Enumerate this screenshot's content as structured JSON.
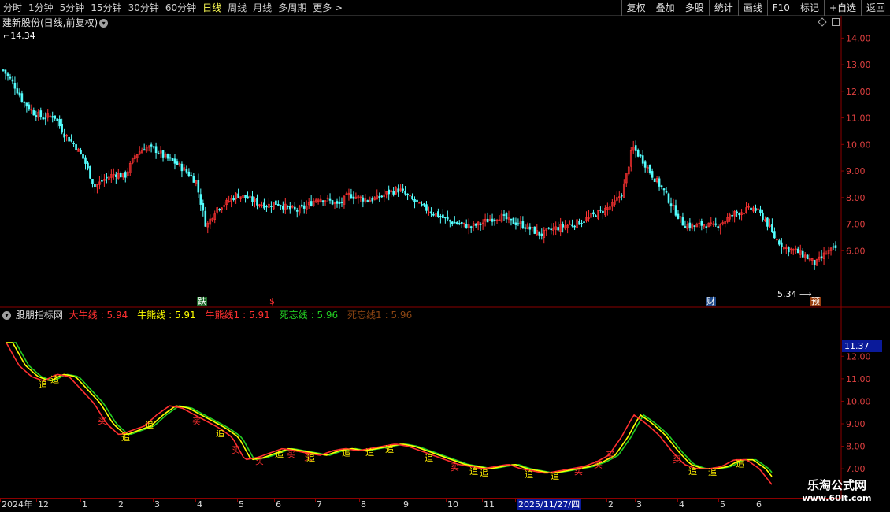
{
  "toolbar": {
    "periods": [
      "分时",
      "1分钟",
      "5分钟",
      "15分钟",
      "30分钟",
      "60分钟",
      "日线",
      "周线",
      "月线",
      "多周期",
      "更多 >"
    ],
    "active_period": "日线",
    "tools": [
      "复权",
      "叠加",
      "多股",
      "统计",
      "画线",
      "F10",
      "标记",
      "+自选",
      "返回"
    ]
  },
  "main_chart": {
    "title": "建新股份(日线,前复权)",
    "high_label": "14.34",
    "low_label": "5.34",
    "markers": {
      "die": "跌",
      "s": "$",
      "cai": "财",
      "yu": "预"
    }
  },
  "indicator": {
    "name": "股朋指标网",
    "lines": [
      {
        "label": "大牛线",
        "value": "5.94",
        "color": "#ff3030"
      },
      {
        "label": "牛熊线",
        "value": "5.91",
        "color": "#ffff00"
      },
      {
        "label": "牛熊线1",
        "value": "5.91",
        "color": "#ff3030"
      },
      {
        "label": "死忘线",
        "value": "5.96",
        "color": "#22cc22"
      },
      {
        "label": "死忘线1",
        "value": "5.96",
        "color": "#8b4513"
      }
    ],
    "current_price": "11.37",
    "signal_labels": {
      "chase": "追",
      "buy": "买"
    }
  },
  "chart_data": [
    {
      "type": "candlestick",
      "title": "建新股份(日线,前复权)",
      "y_ticks": [
        "14.00",
        "13.00",
        "12.00",
        "11.00",
        "10.00",
        "9.00",
        "8.00",
        "7.00",
        "6.00"
      ],
      "ylim": [
        5.0,
        14.9
      ],
      "close_path": [
        12.8,
        12.3,
        11.6,
        11.2,
        11.0,
        11.1,
        10.4,
        10.0,
        9.4,
        8.4,
        8.7,
        8.9,
        8.8,
        9.6,
        9.9,
        9.8,
        9.5,
        9.3,
        9.0,
        8.6,
        6.9,
        7.6,
        7.8,
        8.1,
        8.0,
        7.8,
        7.7,
        7.8,
        7.6,
        7.5,
        7.7,
        8.0,
        7.9,
        7.7,
        8.1,
        8.0,
        7.9,
        8.0,
        8.2,
        8.3,
        8.0,
        7.7,
        7.5,
        7.3,
        7.1,
        7.0,
        6.9,
        7.0,
        7.2,
        7.3,
        7.1,
        7.0,
        6.8,
        6.6,
        6.8,
        6.9,
        7.0,
        7.1,
        7.3,
        7.5,
        7.7,
        8.2,
        9.9,
        9.4,
        8.8,
        8.3,
        7.6,
        7.0,
        6.9,
        7.0,
        6.9,
        7.1,
        7.4,
        7.5,
        7.6,
        7.2,
        6.5,
        6.1,
        6.0,
        5.8,
        5.5,
        5.9,
        6.1
      ],
      "x_ticks": [
        "2024年",
        "12",
        "1",
        "2",
        "3",
        "4",
        "5",
        "6",
        "7",
        "8",
        "9",
        "10",
        "11",
        "2025/11/27/四",
        "2",
        "3",
        "4",
        "5",
        "6"
      ]
    },
    {
      "type": "line",
      "y_ticks": [
        "12.00",
        "11.00",
        "10.00",
        "9.00",
        "8.00",
        "7.00"
      ],
      "ylim": [
        6.2,
        13.2
      ],
      "series": [
        {
          "name": "大牛线",
          "color": "#ff3030"
        },
        {
          "name": "牛熊线",
          "color": "#ffff00"
        },
        {
          "name": "死忘线",
          "color": "#22cc22"
        }
      ],
      "smooth_path": [
        12.6,
        11.6,
        11.1,
        10.9,
        11.2,
        11.1,
        10.5,
        9.9,
        9.0,
        8.5,
        8.7,
        8.9,
        9.4,
        9.8,
        9.7,
        9.4,
        9.1,
        8.8,
        8.4,
        7.4,
        7.5,
        7.7,
        7.9,
        7.8,
        7.7,
        7.6,
        7.8,
        7.9,
        7.8,
        7.9,
        8.0,
        8.1,
        8.0,
        7.8,
        7.6,
        7.4,
        7.2,
        7.1,
        7.0,
        7.1,
        7.2,
        7.0,
        6.9,
        6.8,
        6.9,
        7.0,
        7.1,
        7.3,
        7.6,
        8.4,
        9.4,
        9.0,
        8.5,
        7.8,
        7.2,
        7.0,
        7.0,
        7.1,
        7.4,
        7.4,
        7.0,
        6.3
      ]
    }
  ],
  "date_axis": [
    "2024年",
    "12",
    "1",
    "2",
    "3",
    "4",
    "5",
    "6",
    "7",
    "8",
    "9",
    "10",
    "11",
    "2025/11/27/四",
    "2",
    "3",
    "4",
    "5",
    "6"
  ],
  "watermark": {
    "line1": "乐淘公式网",
    "line2": "www.60lt.com"
  }
}
